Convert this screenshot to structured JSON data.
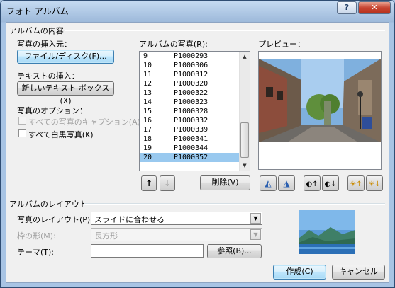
{
  "window": {
    "title": "フォト アルバム",
    "help_label": "?",
    "close_label": "✕"
  },
  "album_content": {
    "group_label": "アルバムの内容",
    "insert_from_label": "写真の挿入元：",
    "file_disk_button": "ファイル/ディスク(F)...",
    "insert_text_label": "テキストの挿入：",
    "new_textbox_button": "新しいテキスト ボックス(X)",
    "photo_options_label": "写真のオプション：",
    "caption_below_all": "すべての写真のキャプション(A)",
    "all_black_white": "すべて白黒写真(K)"
  },
  "photos": {
    "label": "アルバムの写真(R):",
    "items": [
      {
        "num": "9",
        "name": "P1000293"
      },
      {
        "num": "10",
        "name": "P1000306"
      },
      {
        "num": "11",
        "name": "P1000312"
      },
      {
        "num": "12",
        "name": "P1000320"
      },
      {
        "num": "13",
        "name": "P1000322"
      },
      {
        "num": "14",
        "name": "P1000323"
      },
      {
        "num": "15",
        "name": "P1000328"
      },
      {
        "num": "16",
        "name": "P1000332"
      },
      {
        "num": "17",
        "name": "P1000339"
      },
      {
        "num": "18",
        "name": "P1000341"
      },
      {
        "num": "19",
        "name": "P1000344"
      },
      {
        "num": "20",
        "name": "P1000352"
      }
    ],
    "selected_num": "20",
    "move_up_icon": "↑",
    "move_down_icon": "↓",
    "remove_button": "削除(V)"
  },
  "preview": {
    "label": "プレビュー：",
    "image_description": "city street photo"
  },
  "preview_tools": [
    {
      "name": "rotate-left-icon",
      "glyph": "◭"
    },
    {
      "name": "rotate-right-icon",
      "glyph": "◮"
    },
    {
      "name": "contrast-up-icon",
      "glyph": "◐↑"
    },
    {
      "name": "contrast-down-icon",
      "glyph": "◐↓"
    },
    {
      "name": "brightness-up-icon",
      "glyph": "☀↑"
    },
    {
      "name": "brightness-down-icon",
      "glyph": "☀↓"
    }
  ],
  "album_layout": {
    "group_label": "アルバムのレイアウト",
    "picture_layout_label": "写真のレイアウト(P):",
    "picture_layout_value": "スライドに合わせる",
    "frame_shape_label": "枠の形(M):",
    "frame_shape_value": "長方形",
    "theme_label": "テーマ(T):",
    "theme_value": "",
    "browse_button": "参照(B)..."
  },
  "footer": {
    "create_button": "作成(C)",
    "cancel_button": "キャンセル"
  }
}
